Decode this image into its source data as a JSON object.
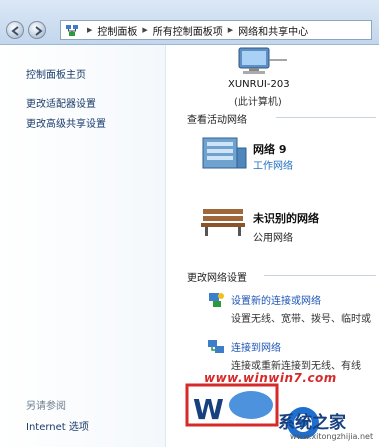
{
  "address": {
    "crumbs": [
      "控制面板",
      "所有控制面板项",
      "网络和共享中心"
    ]
  },
  "sidebar": {
    "items": [
      "控制面板主页",
      "更改适配器设置",
      "更改高级共享设置"
    ],
    "see_also_label": "另请参阅",
    "see_also_items": [
      "Internet 选项"
    ]
  },
  "computer": {
    "name": "XUNRUI-203",
    "subtitle": "(此计算机)"
  },
  "active_networks": {
    "title": "查看活动网络",
    "networks": [
      {
        "name": "网络 9",
        "type": "工作网络"
      },
      {
        "name": "未识别的网络",
        "type": "公用网络"
      }
    ]
  },
  "change_settings": {
    "title": "更改网络设置",
    "tasks": [
      {
        "link": "设置新的连接或网络",
        "desc": "设置无线、宽带、拨号、临时或"
      },
      {
        "link": "连接到网络",
        "desc": "连接或重新连接到无线、有线"
      }
    ]
  },
  "watermark": {
    "url": "www.winwin7.com",
    "brand": "系统之家",
    "brand_url": "www.xitongzhijia.net"
  },
  "colors": {
    "link": "#1c55b5",
    "titlebar": "#c3d6ec"
  }
}
